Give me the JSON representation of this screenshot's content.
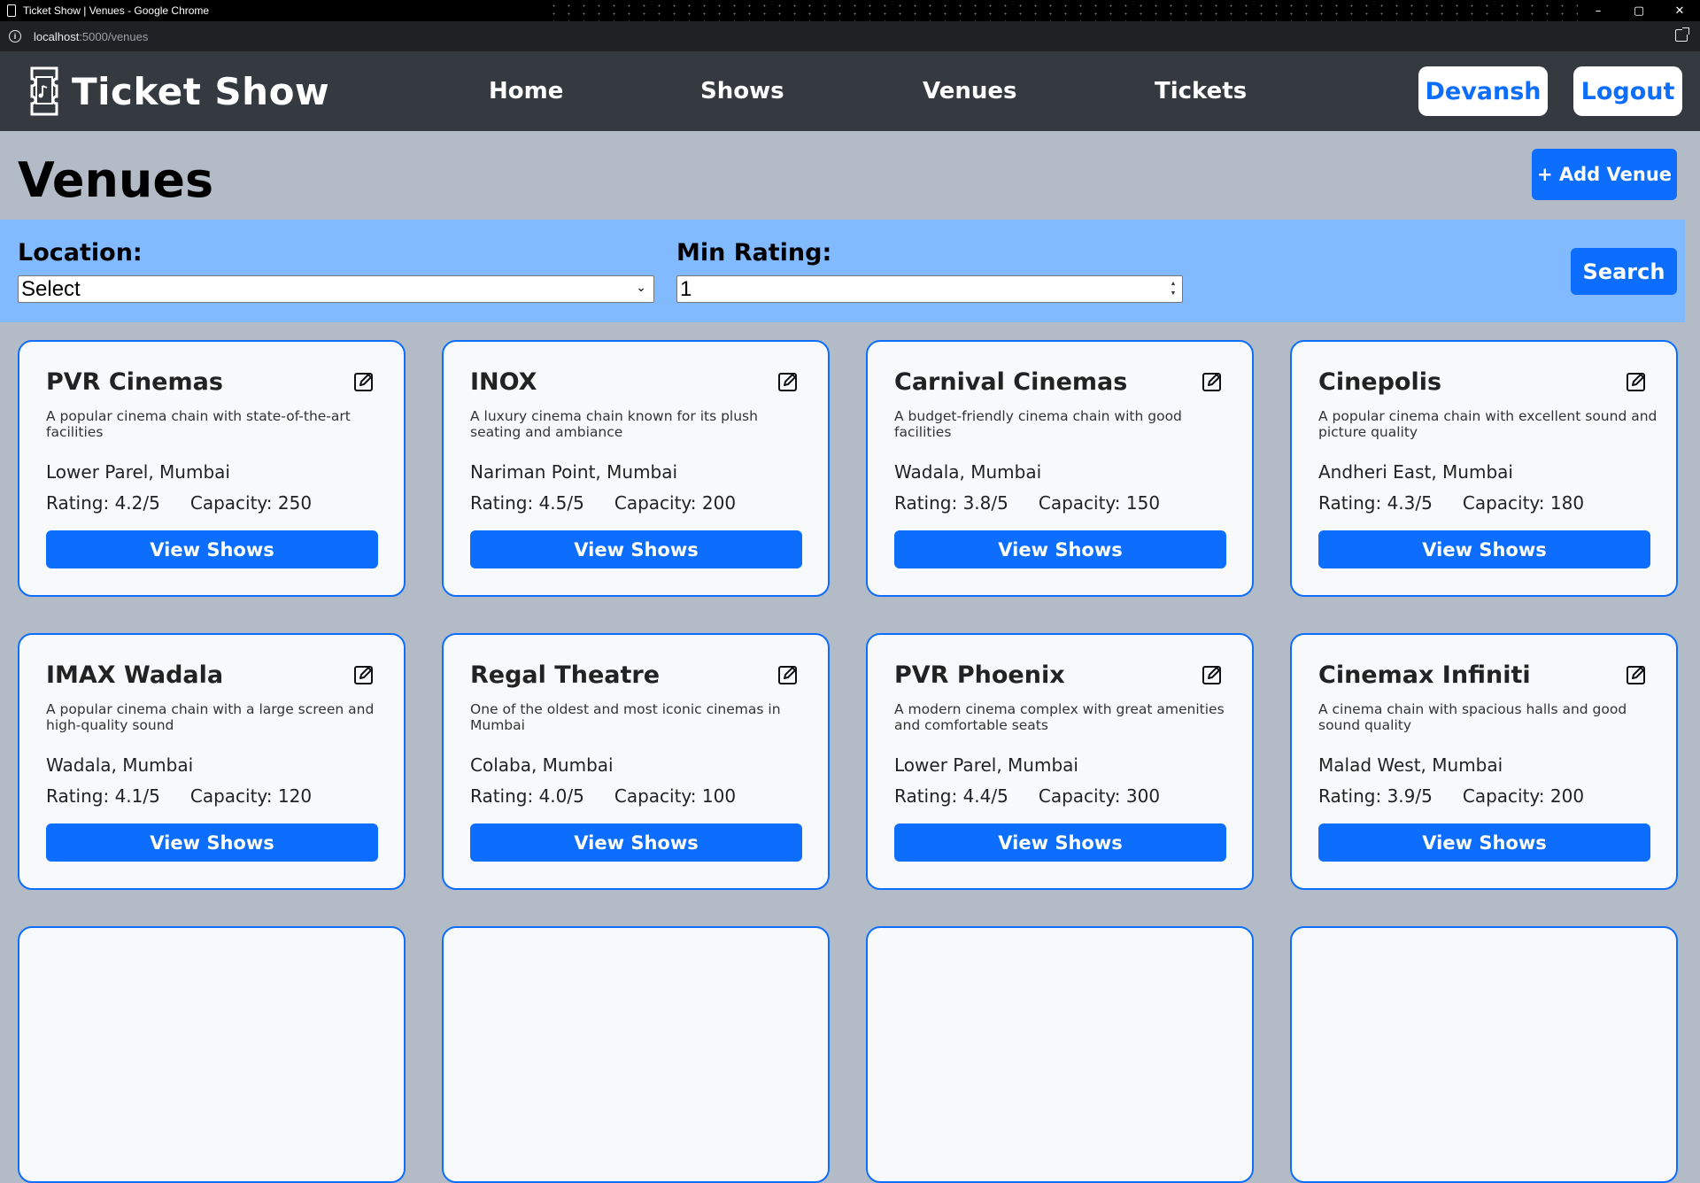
{
  "browser": {
    "window_title": "Ticket Show | Venues - Google Chrome",
    "url_host": "localhost",
    "url_rest": ":5000/venues",
    "controls": [
      "–",
      "▢",
      "✕"
    ]
  },
  "navbar": {
    "brand": "Ticket Show",
    "links": [
      "Home",
      "Shows",
      "Venues",
      "Tickets"
    ],
    "user_button": "Devansh",
    "logout_button": "Logout"
  },
  "header": {
    "title": "Venues",
    "add_button": "+ Add Venue"
  },
  "filters": {
    "location_label": "Location:",
    "location_value": "Select",
    "rating_label": "Min Rating:",
    "rating_value": "1",
    "search_button": "Search"
  },
  "colors": {
    "primary": "#0d6efd",
    "navbar_bg": "#343a40",
    "page_bg": "#b3bcc6",
    "filter_bg": "#82baff",
    "card_bg": "#f8f9fa"
  },
  "venue_button_label": "View Shows",
  "venues": [
    {
      "name": "PVR Cinemas",
      "description": "A popular cinema chain with state-of-the-art facilities",
      "location": "Lower Parel, Mumbai",
      "rating": "Rating: 4.2/5",
      "capacity": "Capacity: 250"
    },
    {
      "name": "INOX",
      "description": "A luxury cinema chain known for its plush seating and ambiance",
      "location": "Nariman Point, Mumbai",
      "rating": "Rating: 4.5/5",
      "capacity": "Capacity: 200"
    },
    {
      "name": "Carnival Cinemas",
      "description": "A budget-friendly cinema chain with good facilities",
      "location": "Wadala, Mumbai",
      "rating": "Rating: 3.8/5",
      "capacity": "Capacity: 150"
    },
    {
      "name": "Cinepolis",
      "description": "A popular cinema chain with excellent sound and picture quality",
      "location": "Andheri East, Mumbai",
      "rating": "Rating: 4.3/5",
      "capacity": "Capacity: 180"
    },
    {
      "name": "IMAX Wadala",
      "description": "A popular cinema chain with a large screen and high-quality sound",
      "location": "Wadala, Mumbai",
      "rating": "Rating: 4.1/5",
      "capacity": "Capacity: 120"
    },
    {
      "name": "Regal Theatre",
      "description": "One of the oldest and most iconic cinemas in Mumbai",
      "location": "Colaba, Mumbai",
      "rating": "Rating: 4.0/5",
      "capacity": "Capacity: 100"
    },
    {
      "name": "PVR Phoenix",
      "description": "A modern cinema complex with great amenities and comfortable seats",
      "location": "Lower Parel, Mumbai",
      "rating": "Rating: 4.4/5",
      "capacity": "Capacity: 300"
    },
    {
      "name": "Cinemax Infiniti",
      "description": "A cinema chain with spacious halls and good sound quality",
      "location": "Malad West, Mumbai",
      "rating": "Rating: 3.9/5",
      "capacity": "Capacity: 200"
    }
  ]
}
